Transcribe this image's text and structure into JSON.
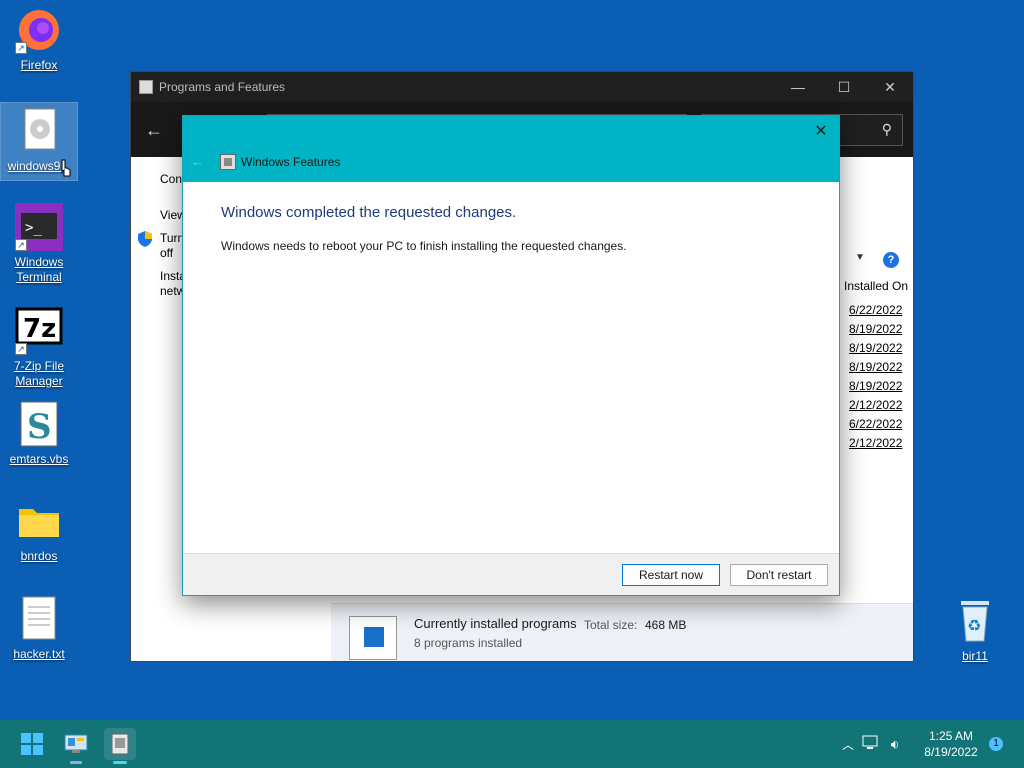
{
  "desktop": {
    "icons": [
      {
        "label": "Firefox"
      },
      {
        "label": "windows9..."
      },
      {
        "label_line1": "Windows",
        "label_line2": "Terminal"
      },
      {
        "label_line1": "7-Zip File",
        "label_line2": "Manager"
      },
      {
        "label": "emtars.vbs"
      },
      {
        "label": "bnrdos"
      },
      {
        "label": "hacker.txt"
      },
      {
        "label": "bir11"
      }
    ]
  },
  "programs_window": {
    "title": "Programs and Features",
    "left_links": [
      "Con",
      "View",
      "Turn",
      "off",
      "Insta",
      "netw"
    ],
    "column_header": "Installed On",
    "dates": [
      "6/22/2022",
      "8/19/2022",
      "8/19/2022",
      "8/19/2022",
      "8/19/2022",
      "2/12/2022",
      "6/22/2022",
      "2/12/2022"
    ],
    "summary": {
      "title": "Currently installed programs",
      "total_size_label": "Total size:",
      "total_size_value": "468 MB",
      "count": "8 programs installed"
    }
  },
  "dialog": {
    "title": "Windows Features",
    "heading": "Windows completed the requested changes.",
    "message": "Windows needs to reboot your PC to finish installing the requested changes.",
    "restart_label": "Restart now",
    "dont_restart_label": "Don't restart"
  },
  "taskbar": {
    "time": "1:25 AM",
    "date": "8/19/2022",
    "notifications": "1"
  },
  "colors": {
    "desktop": "#0a5fb4",
    "dialog_header": "#00b4c5",
    "taskbar": "#127477"
  }
}
